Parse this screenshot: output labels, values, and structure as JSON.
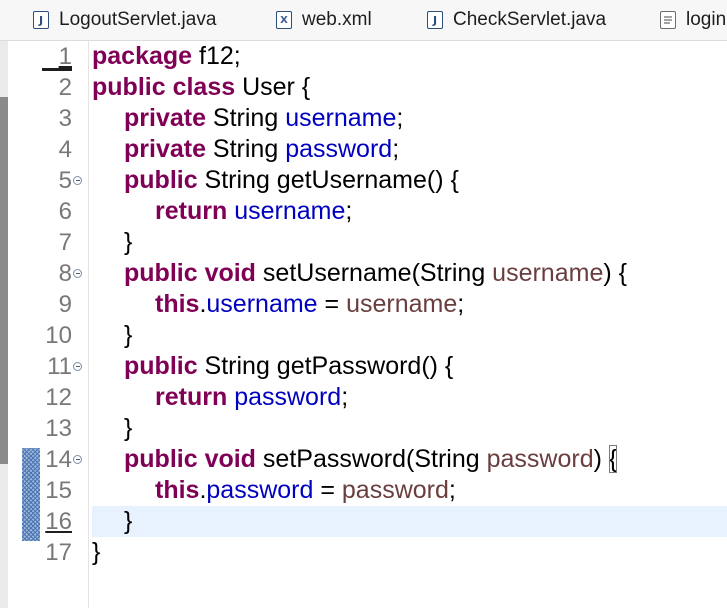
{
  "tabs": [
    {
      "label": "LogoutServlet.java",
      "icon": "java-file-icon"
    },
    {
      "label": "web.xml",
      "icon": "xml-file-icon"
    },
    {
      "label": "CheckServlet.java",
      "icon": "java-file-icon"
    },
    {
      "label": "login",
      "icon": "document-file-icon"
    }
  ],
  "icon_glyphs": {
    "java": "J",
    "xml": "X"
  },
  "colors": {
    "keyword": "#7f0055",
    "field": "#0000c0",
    "parameter": "#6a3e3e",
    "line_number": "#787878",
    "current_line_bg": "#e8f2fe"
  },
  "editor": {
    "current_line": 16,
    "lines": [
      {
        "n": "1",
        "tokens": [
          {
            "t": "package",
            "c": "kw"
          },
          {
            "t": " f12;",
            "c": ""
          }
        ]
      },
      {
        "n": "2",
        "tokens": [
          {
            "t": "public",
            "c": "kw"
          },
          {
            "t": " ",
            "c": ""
          },
          {
            "t": "class",
            "c": "kw"
          },
          {
            "t": " User {",
            "c": ""
          }
        ]
      },
      {
        "n": "3",
        "tokens": [
          {
            "t": "private",
            "c": "kw"
          },
          {
            "t": " String ",
            "c": ""
          },
          {
            "t": "username",
            "c": "fld"
          },
          {
            "t": ";",
            "c": ""
          }
        ]
      },
      {
        "n": "4",
        "tokens": [
          {
            "t": "private",
            "c": "kw"
          },
          {
            "t": " String ",
            "c": ""
          },
          {
            "t": "password",
            "c": "fld"
          },
          {
            "t": ";",
            "c": ""
          }
        ]
      },
      {
        "n": "5",
        "fold": true,
        "tokens": [
          {
            "t": "public",
            "c": "kw"
          },
          {
            "t": " String getUsername() {",
            "c": ""
          }
        ]
      },
      {
        "n": "6",
        "tokens": [
          {
            "t": "return",
            "c": "kw"
          },
          {
            "t": " ",
            "c": ""
          },
          {
            "t": "username",
            "c": "fld"
          },
          {
            "t": ";",
            "c": ""
          }
        ]
      },
      {
        "n": "7",
        "tokens": [
          {
            "t": "}",
            "c": ""
          }
        ]
      },
      {
        "n": "8",
        "fold": true,
        "tokens": [
          {
            "t": "public",
            "c": "kw"
          },
          {
            "t": " ",
            "c": ""
          },
          {
            "t": "void",
            "c": "kw"
          },
          {
            "t": " setUsername(String ",
            "c": ""
          },
          {
            "t": "username",
            "c": "prm"
          },
          {
            "t": ") {",
            "c": ""
          }
        ]
      },
      {
        "n": "9",
        "tokens": [
          {
            "t": "this",
            "c": "kw"
          },
          {
            "t": ".",
            "c": ""
          },
          {
            "t": "username",
            "c": "fld"
          },
          {
            "t": " = ",
            "c": ""
          },
          {
            "t": "username",
            "c": "prm"
          },
          {
            "t": ";",
            "c": ""
          }
        ]
      },
      {
        "n": "10",
        "tokens": [
          {
            "t": "}",
            "c": ""
          }
        ]
      },
      {
        "n": "11",
        "fold": true,
        "tokens": [
          {
            "t": "public",
            "c": "kw"
          },
          {
            "t": " String getPassword() {",
            "c": ""
          }
        ]
      },
      {
        "n": "12",
        "tokens": [
          {
            "t": "return",
            "c": "kw"
          },
          {
            "t": " ",
            "c": ""
          },
          {
            "t": "password",
            "c": "fld"
          },
          {
            "t": ";",
            "c": ""
          }
        ]
      },
      {
        "n": "13",
        "tokens": [
          {
            "t": "}",
            "c": ""
          }
        ]
      },
      {
        "n": "14",
        "fold": true,
        "tokens": [
          {
            "t": "public",
            "c": "kw"
          },
          {
            "t": " ",
            "c": ""
          },
          {
            "t": "void",
            "c": "kw"
          },
          {
            "t": " setPassword(String ",
            "c": ""
          },
          {
            "t": "password",
            "c": "prm"
          },
          {
            "t": ") ",
            "c": ""
          },
          {
            "t": "{",
            "c": "brk"
          }
        ]
      },
      {
        "n": "15",
        "tokens": [
          {
            "t": "this",
            "c": "kw"
          },
          {
            "t": ".",
            "c": ""
          },
          {
            "t": "password",
            "c": "fld"
          },
          {
            "t": " = ",
            "c": ""
          },
          {
            "t": "password",
            "c": "prm"
          },
          {
            "t": ";",
            "c": ""
          }
        ]
      },
      {
        "n": "16",
        "tokens": [
          {
            "t": "}",
            "c": ""
          }
        ]
      },
      {
        "n": "17",
        "tokens": [
          {
            "t": "}",
            "c": ""
          }
        ]
      }
    ]
  }
}
